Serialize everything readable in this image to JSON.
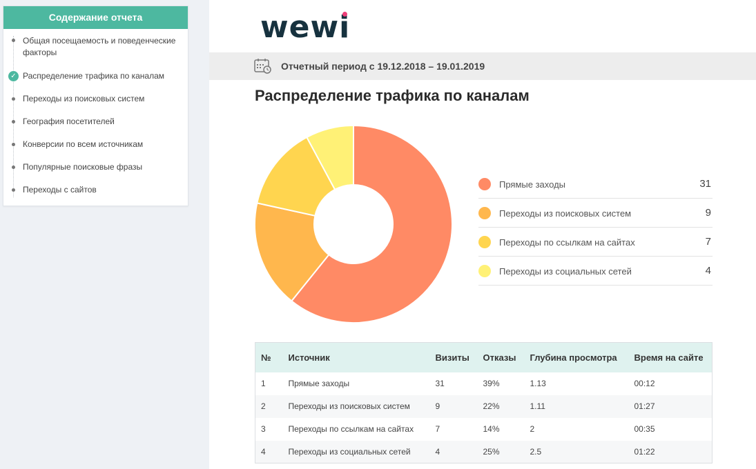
{
  "sidebar": {
    "title": "Содержание отчета",
    "items": [
      {
        "label": "Общая посещаемость и поведенческие факторы",
        "active": false
      },
      {
        "label": "Распределение трафика по каналам",
        "active": true
      },
      {
        "label": "Переходы из поисковых систем",
        "active": false
      },
      {
        "label": "География посетителей",
        "active": false
      },
      {
        "label": "Конверсии по всем источникам",
        "active": false
      },
      {
        "label": "Популярные поисковые фразы",
        "active": false
      },
      {
        "label": "Переходы с сайтов",
        "active": false
      }
    ]
  },
  "header": {
    "logo": "wewi",
    "period": "Отчетный период с 19.12.2018 – 19.01.2019"
  },
  "page_title": "Распределение трафика по каналам",
  "colors": {
    "accent": "#4db8a0",
    "logo_dot": "#ee3f79",
    "slices": [
      "#ff8a65",
      "#ffb74d",
      "#ffd54f",
      "#fff176"
    ]
  },
  "chart_data": {
    "type": "pie",
    "categories": [
      "Прямые заходы",
      "Переходы из поисковых систем",
      "Переходы по ссылкам на сайтах",
      "Переходы из социальных сетей"
    ],
    "values": [
      31,
      9,
      7,
      4
    ]
  },
  "legend": [
    {
      "label": "Прямые заходы",
      "value": "31"
    },
    {
      "label": "Переходы из поисковых систем",
      "value": "9"
    },
    {
      "label": "Переходы по ссылкам на сайтах",
      "value": "7"
    },
    {
      "label": "Переходы из социальных сетей",
      "value": "4"
    }
  ],
  "table": {
    "headers": [
      "№",
      "Источник",
      "Визиты",
      "Отказы",
      "Глубина просмотра",
      "Время на сайте"
    ],
    "rows": [
      [
        "1",
        "Прямые заходы",
        "31",
        "39%",
        "1.13",
        "00:12"
      ],
      [
        "2",
        "Переходы из поисковых систем",
        "9",
        "22%",
        "1.11",
        "01:27"
      ],
      [
        "3",
        "Переходы по ссылкам на сайтах",
        "7",
        "14%",
        "2",
        "00:35"
      ],
      [
        "4",
        "Переходы из социальных сетей",
        "4",
        "25%",
        "2.5",
        "01:22"
      ]
    ]
  }
}
